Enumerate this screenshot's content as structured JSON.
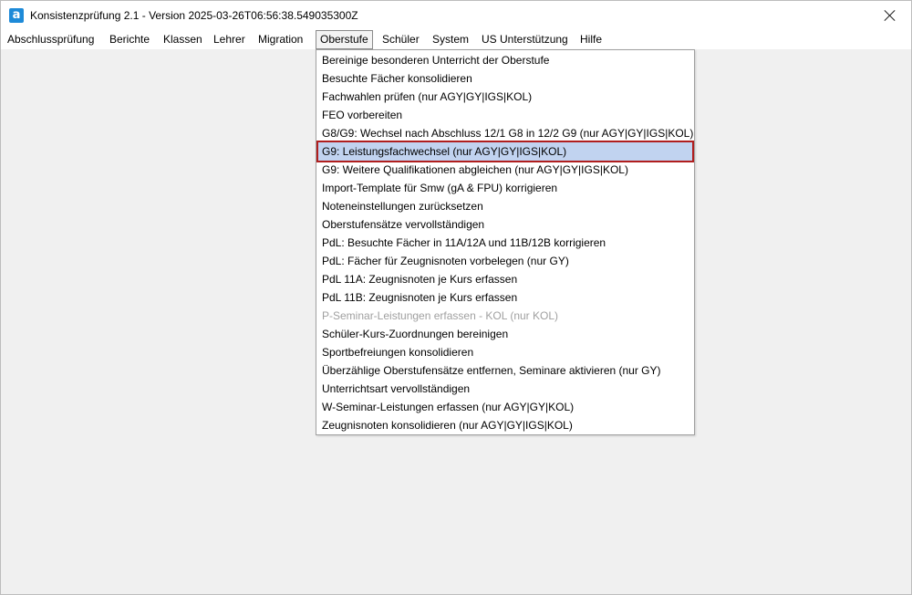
{
  "window": {
    "title": "Konsistenzprüfung 2.1 - Version 2025-03-26T06:56:38.549035300Z",
    "app_icon_letter": "a"
  },
  "menubar": {
    "items": [
      {
        "label": "Abschlussprüfung"
      },
      {
        "label": "Berichte"
      },
      {
        "label": "Klassen"
      },
      {
        "label": "Lehrer"
      },
      {
        "label": "Migration"
      },
      {
        "label": "Oberstufe"
      },
      {
        "label": "Schüler"
      },
      {
        "label": "System"
      },
      {
        "label": "US Unterstützung"
      },
      {
        "label": "Hilfe"
      }
    ],
    "active": "Oberstufe"
  },
  "dropdown": {
    "items": [
      {
        "label": "Bereinige besonderen Unterricht der Oberstufe"
      },
      {
        "label": "Besuchte Fächer konsolidieren"
      },
      {
        "label": "Fachwahlen prüfen (nur AGY|GY|IGS|KOL)"
      },
      {
        "label": "FEO vorbereiten"
      },
      {
        "label": "G8/G9: Wechsel nach Abschluss 12/1 G8 in 12/2 G9 (nur AGY|GY|IGS|KOL)"
      },
      {
        "label": "G9: Leistungsfachwechsel (nur AGY|GY|IGS|KOL)"
      },
      {
        "label": "G9: Weitere Qualifikationen abgleichen (nur AGY|GY|IGS|KOL)"
      },
      {
        "label": "Import-Template für Smw (gA & FPU) korrigieren"
      },
      {
        "label": "Noteneinstellungen zurücksetzen"
      },
      {
        "label": "Oberstufensätze vervollständigen"
      },
      {
        "label": "PdL: Besuchte Fächer in 11A/12A und 11B/12B korrigieren"
      },
      {
        "label": "PdL: Fächer für Zeugnisnoten vorbelegen (nur GY)"
      },
      {
        "label": "PdL 11A: Zeugnisnoten je Kurs erfassen"
      },
      {
        "label": "PdL 11B: Zeugnisnoten je Kurs erfassen"
      },
      {
        "label": "P-Seminar-Leistungen erfassen - KOL (nur KOL)"
      },
      {
        "label": "Schüler-Kurs-Zuordnungen bereinigen"
      },
      {
        "label": "Sportbefreiungen konsolidieren"
      },
      {
        "label": "Überzählige Oberstufensätze entfernen, Seminare aktivieren (nur GY)"
      },
      {
        "label": "Unterrichtsart vervollständigen"
      },
      {
        "label": "W-Seminar-Leistungen erfassen (nur AGY|GY|KOL)"
      },
      {
        "label": "Zeugnisnoten konsolidieren (nur AGY|GY|IGS|KOL)"
      }
    ],
    "highlighted_index": 5,
    "disabled_index": 14,
    "highlight_color": "#c1d3f0",
    "highlight_border_color": "#b01e1e"
  }
}
